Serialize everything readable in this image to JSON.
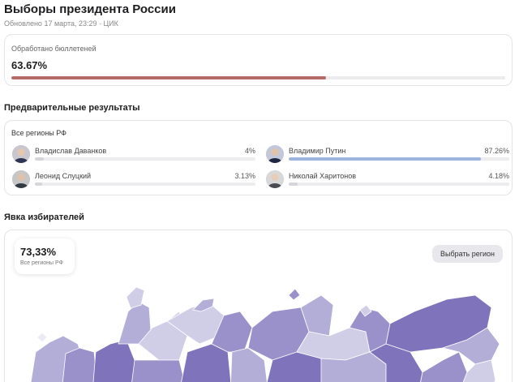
{
  "header": {
    "title": "Выборы президента России",
    "updated": "Обновлено 17 марта, 23:29 · ЦИК"
  },
  "processed": {
    "label": "Обработано бюллетеней",
    "value": "63.67%",
    "fraction": 0.6367,
    "bar_color": "#b56a6a"
  },
  "results": {
    "section_title": "Предварительные результаты",
    "region": "Все регионы РФ",
    "candidates": [
      {
        "name": "Владислав Даванков",
        "percent": "4%",
        "fraction": 0.04,
        "bar_color": "#d5d5dc",
        "icon": "person-avatar-icon"
      },
      {
        "name": "Владимир Путин",
        "percent": "87.26%",
        "fraction": 0.8726,
        "bar_color": "#9db4dd",
        "icon": "person-avatar-icon"
      },
      {
        "name": "Леонид Слуцкий",
        "percent": "3.13%",
        "fraction": 0.0313,
        "bar_color": "#d5d5dc",
        "icon": "person-avatar-icon"
      },
      {
        "name": "Николай Харитонов",
        "percent": "4.18%",
        "fraction": 0.0418,
        "bar_color": "#d5d5dc",
        "icon": "person-avatar-icon"
      }
    ]
  },
  "turnout": {
    "section_title": "Явка избирателей",
    "value": "73,33%",
    "scope": "Все регионы РФ",
    "select_region_button": "Выбрать регион",
    "map_colors": [
      "#ecebf5",
      "#d0cde7",
      "#b3aed8",
      "#9a91cb",
      "#7f73bb"
    ]
  }
}
